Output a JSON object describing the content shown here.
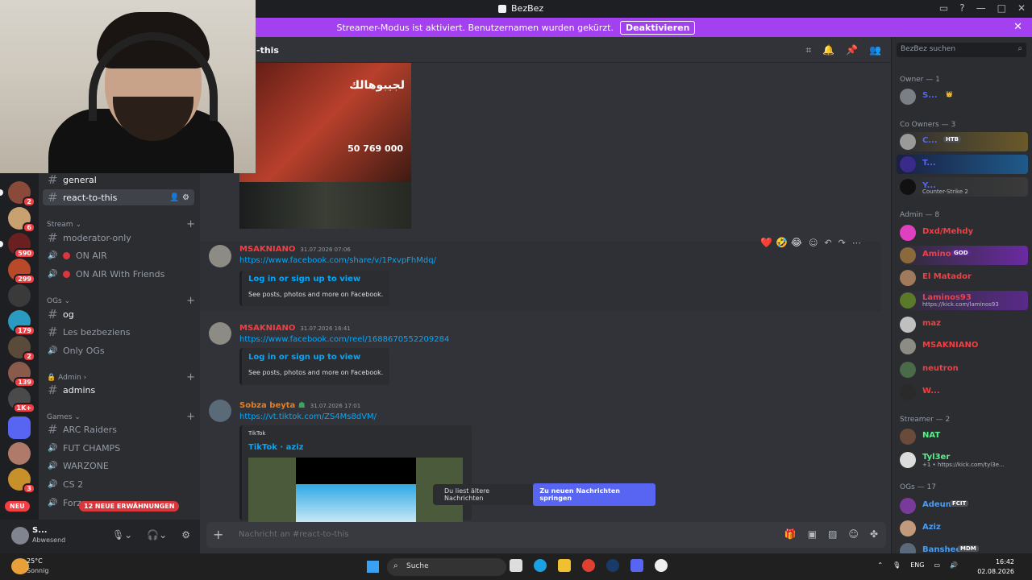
{
  "window": {
    "title": "BezBez"
  },
  "banner": {
    "text": "Streamer-Modus ist aktiviert. Benutzernamen wurden gekürzt.",
    "button": "Deaktivieren"
  },
  "server_badges": [
    "2",
    "6",
    "590",
    "299",
    "179",
    "2",
    "139",
    "1K+",
    "3"
  ],
  "server_new_label": "NEU",
  "mention_label": "12 NEUE ERWÄHNUNGEN",
  "channels": {
    "general": "general",
    "react": "react-to-this",
    "cat_stream": "Stream",
    "moderator": "moderator-only",
    "on_air": "ON AIR",
    "on_air_friends": "ON AIR With Friends",
    "cat_ogs": "OGs",
    "og": "og",
    "les": "Les bezbeziens",
    "only_ogs": "Only OGs",
    "cat_admin": "Admin",
    "admins": "admins",
    "cat_games": "Games",
    "arc": "ARC Raiders",
    "fut": "FUT CHAMPS",
    "warzone": "WARZONE",
    "cs2": "CS 2",
    "forza": "Forza"
  },
  "user": {
    "name": "S...",
    "status": "Abwesend"
  },
  "topbar": {
    "channel": "-this"
  },
  "billboard": {
    "text": "لجيبوهالك",
    "phone": "50 769 000"
  },
  "messages": [
    {
      "author": "MSAKNIANO",
      "time": "31.07.2026 07:06",
      "link": "https://www.facebook.com/share/v/1PxvpFhMdq/",
      "embed_title": "Log in or sign up to view",
      "embed_desc": "See posts, photos and more on Facebook."
    },
    {
      "author": "MSAKNIANO",
      "time": "31.07.2026 16:41",
      "link": "https://www.facebook.com/reel/1688670552209284",
      "embed_title": "Log in or sign up to view",
      "embed_desc": "See posts, photos and more on Facebook."
    },
    {
      "author": "Sobza beyta",
      "time": "31.07.2026 17:01",
      "link": "https://vt.tiktok.com/ZS4Ms8dVM/",
      "embed_provider": "TikTok",
      "embed_title": "TikTok · aziz"
    }
  ],
  "jump": {
    "text": "Du liest ältere Nachrichten",
    "button": "Zu neuen Nachrichten springen"
  },
  "composer": {
    "placeholder": "Nachricht an #react-to-this"
  },
  "members": {
    "search": "BezBez suchen",
    "cat_owner": "Owner — 1",
    "cat_co": "Co Owners — 3",
    "cat_admin": "Admin — 8",
    "cat_streamer": "Streamer — 2",
    "cat_ogs": "OGs — 17",
    "owner": "S...",
    "co1": "C...",
    "co1_tag": "HTB",
    "co2": "T...",
    "co3": "Y...",
    "co3_sub": "Counter-Strike 2",
    "a1": "Dxd/Mehdy",
    "a2": "Amino",
    "a2_tag": "GOD",
    "a3": "El Matador",
    "a4": "Laminos93",
    "a4_sub": "https://kick.com/laminos93",
    "a5": "maz",
    "a6": "MSAKNIANO",
    "a7": "neutron",
    "a8": "W...",
    "s1": "NAT",
    "s2": "Tyl3er",
    "s2_sub": "+1 • https://kick.com/tyl3e...",
    "o1": "Adeum",
    "o1_tag": "FCIT",
    "o2": "Aziz",
    "o3": "Banshee",
    "o3_tag": "MDM"
  },
  "taskbar": {
    "temp": "25°C",
    "condition": "Sonnig",
    "search": "Suche",
    "lang": "ENG",
    "time": "16:42",
    "date": "02.08.2026"
  },
  "colors": {
    "accent": "#5865f2",
    "banner": "#a340f0",
    "author_red": "#f23f43",
    "author_orange": "#e67e22"
  }
}
